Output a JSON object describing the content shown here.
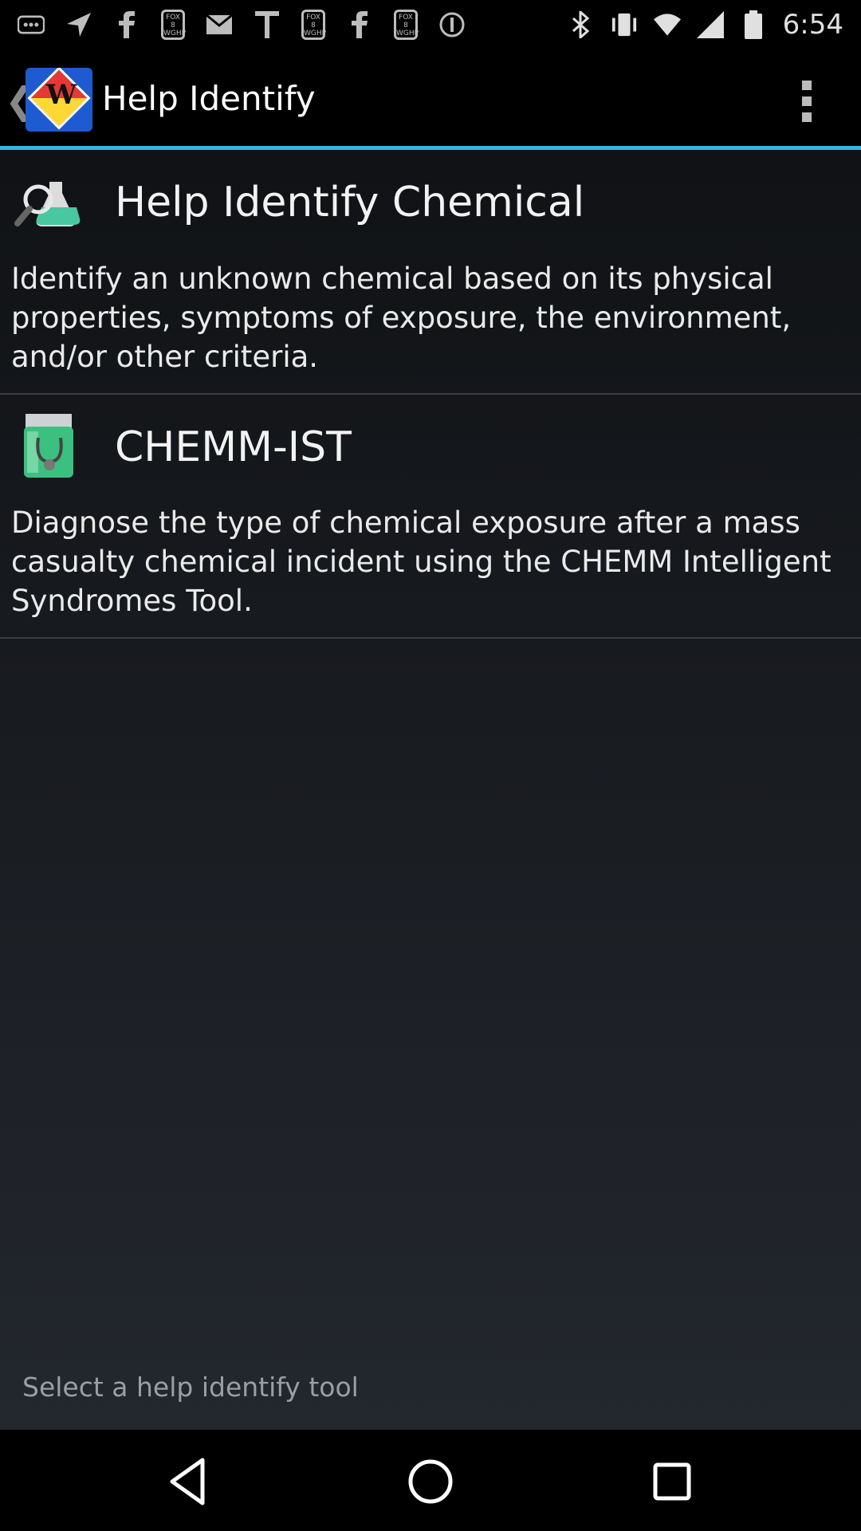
{
  "status_bar": {
    "time": "6:54",
    "left_icons": [
      "more-notifications-icon",
      "navigation-icon",
      "facebook-icon",
      "fox8-icon",
      "gmail-icon",
      "text-icon",
      "fox8-icon",
      "facebook-icon",
      "fox8-icon",
      "info-icon"
    ],
    "right_icons": [
      "bluetooth-icon",
      "vibrate-icon",
      "wifi-icon",
      "signal-icon",
      "battery-icon"
    ],
    "fox_label": "FOX 8 WGHP"
  },
  "action_bar": {
    "title": "Help Identify",
    "logo_letter": "W"
  },
  "items": [
    {
      "heading": "Help Identify Chemical",
      "description": "Identify an unknown chemical based on its physical properties, symptoms of exposure, the environment, and/or other criteria."
    },
    {
      "heading": "CHEMM-IST",
      "description": "Diagnose the type of chemical exposure after a mass casualty chemical incident using the CHEMM Intelligent Syndromes Tool."
    }
  ],
  "footer": {
    "hint": "Select a help identify tool"
  },
  "colors": {
    "accent": "#33b5e5",
    "background_top": "#101215",
    "background_bottom": "#23272e"
  }
}
